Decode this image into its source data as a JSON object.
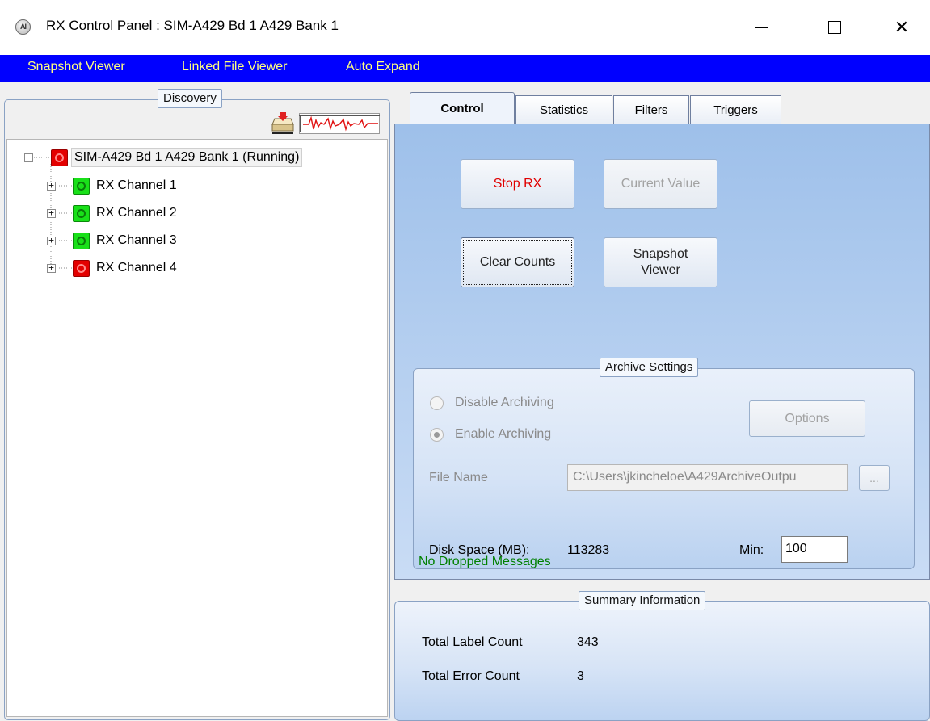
{
  "window": {
    "icon_text": "AI",
    "title": "RX Control Panel : SIM-A429 Bd 1 A429 Bank 1",
    "close_glyph": "✕"
  },
  "menu": {
    "items": [
      "Snapshot Viewer",
      "Linked File Viewer",
      "Auto Expand"
    ]
  },
  "discovery": {
    "legend": "Discovery",
    "root": {
      "label": "SIM-A429 Bd 1 A429 Bank 1 (Running)",
      "status": "red",
      "expanded": true
    },
    "channels": [
      {
        "label": "RX Channel 1",
        "status": "green"
      },
      {
        "label": "RX Channel 2",
        "status": "green"
      },
      {
        "label": "RX Channel 3",
        "status": "green"
      },
      {
        "label": "RX Channel 4",
        "status": "red"
      }
    ],
    "collapse_glyph": "−",
    "expand_glyph": "+"
  },
  "tabs": [
    "Control",
    "Statistics",
    "Filters",
    "Triggers"
  ],
  "active_tab": "Control",
  "control": {
    "stop_rx": "Stop RX",
    "current_value": "Current Value",
    "clear_counts": "Clear Counts",
    "snapshot_viewer_line1": "Snapshot",
    "snapshot_viewer_line2": "Viewer"
  },
  "archive": {
    "legend": "Archive Settings",
    "disable_label": "Disable Archiving",
    "enable_label": "Enable Archiving",
    "selected": "Enable Archiving",
    "options_button": "Options",
    "file_name_label": "File Name",
    "file_name_value": "C:\\Users\\jkincheloe\\A429ArchiveOutpu",
    "browse_button": "...",
    "disk_space_label": "Disk Space (MB):",
    "disk_space_value": "113283",
    "min_label": "Min:",
    "min_value": "100"
  },
  "dropped_status": "No Dropped Messages",
  "summary": {
    "legend": "Summary Information",
    "total_label_count_label": "Total Label Count",
    "total_label_count_value": "343",
    "total_error_count_label": "Total Error Count",
    "total_error_count_value": "3"
  },
  "colors": {
    "menu_bg": "#0000ff",
    "menu_text": "#ffff80",
    "stop_text": "#e00000",
    "dropped_text": "#008000",
    "led_red": "#e30000",
    "led_green": "#19e019"
  }
}
